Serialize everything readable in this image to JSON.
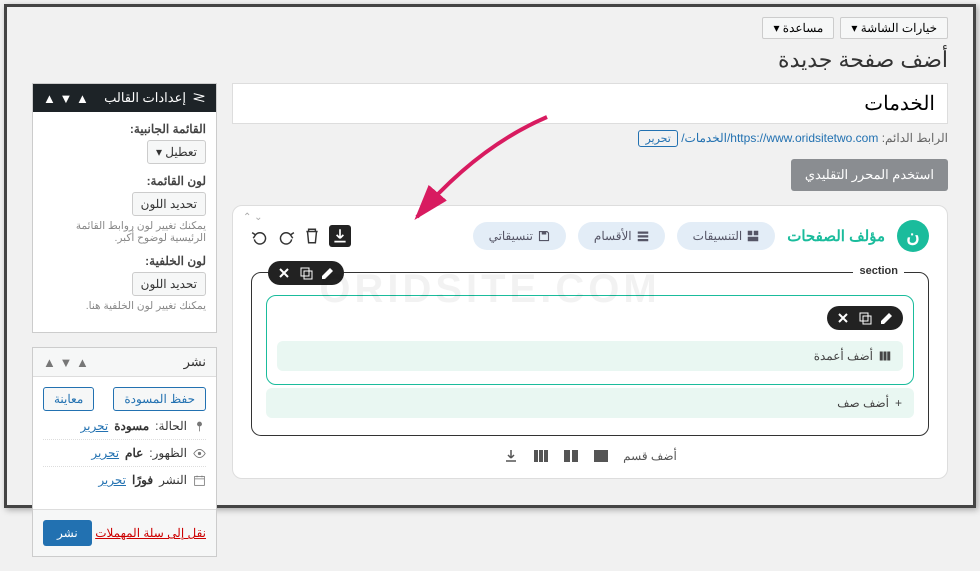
{
  "top_bar": {
    "screen_options": "خيارات الشاشة ▾",
    "help": "مساعدة ▾"
  },
  "page_heading": "أضف صفحة جديدة",
  "title_input_value": "الخدمات",
  "permalink": {
    "label": "الرابط الدائم:",
    "url_base": "https://www.oridsitetwo.com",
    "slug": "/الخدمات/",
    "edit_btn": "تحرير"
  },
  "classic_editor_btn": "استخدم المحرر التقليدي",
  "builder": {
    "name": "مؤلف الصفحات",
    "tabs": {
      "layouts": "التنسيقات",
      "sections": "الأقسام",
      "my_layouts": "تنسيقاتي"
    },
    "section_label": "section",
    "add_columns": "أضف أعمدة",
    "add_row": "أضف صف",
    "add_section": "أضف قسم"
  },
  "sidebar": {
    "theme_settings": {
      "title": "إعدادات القالب",
      "side_menu_label": "القائمة الجانبية:",
      "side_menu_value": "تعطيل ▾",
      "menu_color_label": "لون القائمة:",
      "color_btn": "تحديد اللون",
      "menu_hint": "يمكنك تغيير لون روابط القائمة الرئيسية لوضوح أكبر.",
      "bg_color_label": "لون الخلفية:",
      "bg_hint": "يمكنك تغيير لون الخلفية هنا."
    },
    "publish": {
      "title": "نشر",
      "save_draft": "حفظ المسودة",
      "preview": "معاينة",
      "status_label": "الحالة:",
      "status_value": "مسودة",
      "status_edit": "تحرير",
      "visibility_label": "الظهور:",
      "visibility_value": "عام",
      "visibility_edit": "تحرير",
      "publish_label": "النشر",
      "publish_value": "فورًا",
      "publish_edit": "تحرير",
      "trash": "نقل إلى سلة المهملات",
      "submit": "نشر"
    }
  },
  "watermark": "ORIDSITE.COM"
}
